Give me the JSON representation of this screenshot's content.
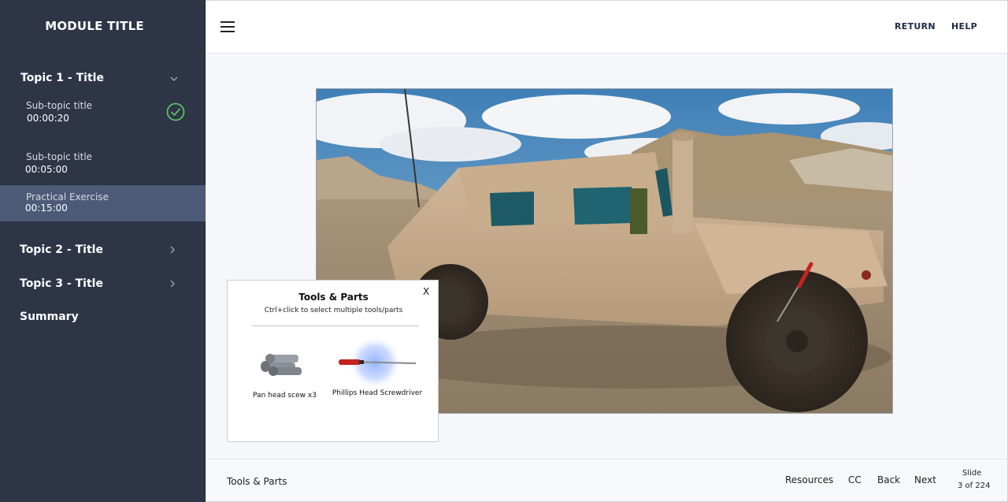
{
  "sidebar": {
    "module_title": "MODULE TITLE",
    "topics": [
      {
        "label": "Topic 1 - Title",
        "expanded": true,
        "subtopics": [
          {
            "label": "Sub-topic title",
            "time": "00:00:20",
            "completed": true
          },
          {
            "label": "Sub-topic title",
            "time": "00:05:00",
            "completed": false
          },
          {
            "label": "Practical Exercise",
            "time": "00:15:00",
            "active": true
          }
        ]
      },
      {
        "label": "Topic 2 - Title",
        "expanded": false
      },
      {
        "label": "Topic 3 - Title",
        "expanded": false
      }
    ],
    "summary_label": "Summary",
    "check_color": "#58c25a"
  },
  "header": {
    "menu_icon": "hamburger-icon",
    "return_label": "RETURN",
    "help_label": "HELP"
  },
  "popup": {
    "title": "Tools & Parts",
    "subtitle": "Ctrl+click to select multiple tools/parts",
    "close_label": "X",
    "tools": [
      {
        "label": "Pan head scew x3",
        "icon": "screws-icon"
      },
      {
        "label": "Phillips Head Screwdriver",
        "icon": "screwdriver-icon",
        "selected": true
      }
    ]
  },
  "footer": {
    "title": "Tools & Parts",
    "resources_label": "Resources",
    "cc_label": "CC",
    "back_label": "Back",
    "next_label": "Next",
    "slide_label": "Slide",
    "slide_count": "3 of 224"
  },
  "colors": {
    "sidebar_bg": "#2e3547",
    "active_item_bg": "#4b5a77",
    "accent_green": "#58c25a",
    "selected_glow": "#8fb0ff"
  }
}
